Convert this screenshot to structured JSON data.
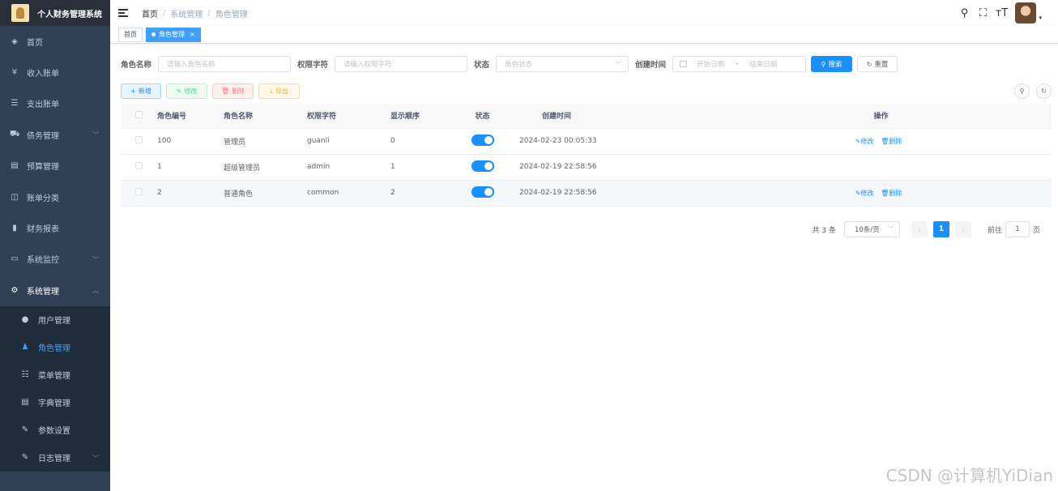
{
  "app": {
    "title": "个人财务管理系统"
  },
  "sidebar": {
    "items": [
      {
        "label": "首页",
        "icon": "dashboard-icon",
        "glyph": "◈"
      },
      {
        "label": "收入账单",
        "icon": "yen-icon",
        "glyph": "¥"
      },
      {
        "label": "支出账单",
        "icon": "list-icon",
        "glyph": "☰"
      },
      {
        "label": "债务管理",
        "icon": "car-icon",
        "glyph": "⛟",
        "arrow": "﹀"
      },
      {
        "label": "预算管理",
        "icon": "document-icon",
        "glyph": "▤"
      },
      {
        "label": "账单分类",
        "icon": "book-icon",
        "glyph": "◫"
      },
      {
        "label": "财务报表",
        "icon": "bar-chart-icon",
        "glyph": "▮"
      },
      {
        "label": "系统监控",
        "icon": "monitor-icon",
        "glyph": "▭",
        "arrow": "﹀"
      },
      {
        "label": "系统管理",
        "icon": "gear-icon",
        "glyph": "⚙",
        "arrow": "︿"
      }
    ],
    "submenu": [
      {
        "label": "用户管理",
        "icon": "user-icon",
        "glyph": "●"
      },
      {
        "label": "角色管理",
        "icon": "peoples-icon",
        "glyph": "♟"
      },
      {
        "label": "菜单管理",
        "icon": "tree-table-icon",
        "glyph": "☷"
      },
      {
        "label": "字典管理",
        "icon": "dict-icon",
        "glyph": "▤"
      },
      {
        "label": "参数设置",
        "icon": "edit-icon",
        "glyph": "✎"
      },
      {
        "label": "日志管理",
        "icon": "log-icon",
        "glyph": "✎",
        "arrow": "﹀"
      }
    ]
  },
  "navbar": {
    "breadcrumb": [
      "首页",
      "系统管理",
      "角色管理"
    ],
    "sep": "/",
    "icons": {
      "search": "⚲",
      "fullscreen": "⛶",
      "size": "тT"
    },
    "caret": "▾"
  },
  "tags": [
    {
      "label": "首页"
    },
    {
      "label": "角色管理",
      "close": "×"
    }
  ],
  "search": {
    "role_name_label": "角色名称",
    "role_name_placeholder": "请输入角色名称",
    "perm_label": "权限字符",
    "perm_placeholder": "请输入权限字符",
    "status_label": "状态",
    "status_placeholder": "角色状态",
    "status_caret": "﹀",
    "created_label": "创建时间",
    "start_placeholder": "开始日期",
    "range_sep": "-",
    "end_placeholder": "结束日期",
    "search_btn": "搜索",
    "search_icon": "⚲",
    "reset_btn": "重置",
    "reset_icon": "↻"
  },
  "toolbar": {
    "add": "新增",
    "add_icon": "+",
    "edit": "修改",
    "edit_icon": "✎",
    "delete": "删除",
    "delete_icon": "🗑",
    "export": "导出",
    "export_icon": "⤓",
    "search_toggle_icon": "⚲",
    "refresh_icon": "↻"
  },
  "table": {
    "columns": [
      "角色编号",
      "角色名称",
      "权限字符",
      "显示顺序",
      "状态",
      "创建时间",
      "操作"
    ],
    "rows": [
      {
        "id": "100",
        "name": "管理员",
        "key": "guanli",
        "sort": "0",
        "status": true,
        "created": "2024-02-23 00:05:33",
        "edit": "✎修改",
        "delete": "🗑删除"
      },
      {
        "id": "1",
        "name": "超级管理员",
        "key": "admin",
        "sort": "1",
        "status": true,
        "created": "2024-02-19 22:58:56",
        "edit": "",
        "delete": ""
      },
      {
        "id": "2",
        "name": "普通角色",
        "key": "common",
        "sort": "2",
        "status": true,
        "created": "2024-02-19 22:58:56",
        "edit": "✎修改",
        "delete": "🗑删除"
      }
    ]
  },
  "pagination": {
    "total": "共 3 条",
    "page_size": "10条/页",
    "prev": "‹",
    "current": "1",
    "next": "›",
    "goto_label": "前往",
    "goto_value": "1",
    "page_unit": "页"
  },
  "watermark": "CSDN @计算机YiDian",
  "colors": {
    "sidebar_bg": "#304156",
    "submenu_bg": "#1f2d3d",
    "primary": "#1890ff",
    "active_menu": "#409eff"
  }
}
